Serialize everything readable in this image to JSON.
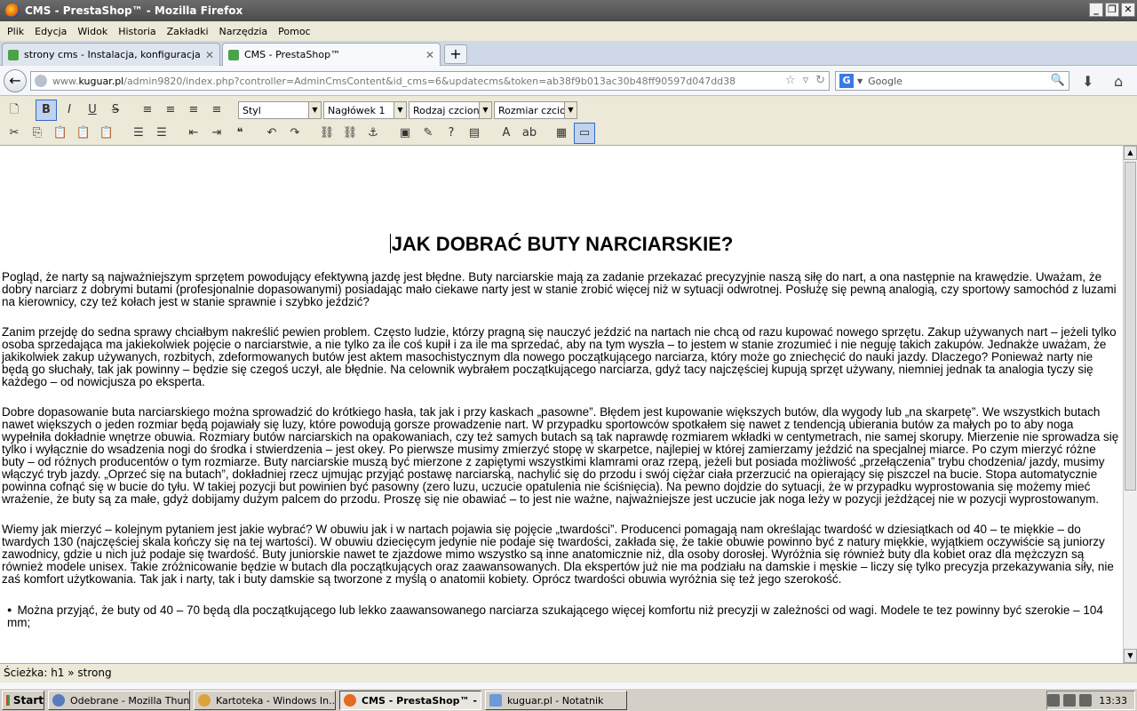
{
  "window": {
    "title": "CMS - PrestaShop™ - Mozilla Firefox",
    "buttons": [
      "_",
      "❐",
      "✕"
    ]
  },
  "menu": [
    "Plik",
    "Edycja",
    "Widok",
    "Historia",
    "Zakładki",
    "Narzędzia",
    "Pomoc"
  ],
  "tabs": [
    {
      "label": "strony cms - Instalacja, konfiguracja i aktu...",
      "active": false
    },
    {
      "label": "CMS - PrestaShop™",
      "active": true
    }
  ],
  "newtab_label": "+",
  "nav": {
    "url_prefix": "www.",
    "url_host": "kuguar.pl",
    "url_path": "/admin9820/index.php?controller=AdminCmsContent&id_cms=6&updatecms&token=ab38f9b013ac30b48ff90597d047dd38",
    "search_engine": "G",
    "search_placeholder": "Google"
  },
  "toolbar": {
    "row1_buttons": [
      {
        "name": "new-doc-icon",
        "glyph": "🗋",
        "on": false
      },
      {
        "name": "bold-button",
        "glyph": "B",
        "on": true
      },
      {
        "name": "italic-button",
        "glyph": "I",
        "on": false
      },
      {
        "name": "underline-button",
        "glyph": "U",
        "on": false
      },
      {
        "name": "strike-button",
        "glyph": "S",
        "on": false
      },
      {
        "name": "align-left-icon",
        "glyph": "≡",
        "on": false
      },
      {
        "name": "align-center-icon",
        "glyph": "≡",
        "on": false
      },
      {
        "name": "align-right-icon",
        "glyph": "≡",
        "on": false
      },
      {
        "name": "align-justify-icon",
        "glyph": "≡",
        "on": false
      }
    ],
    "style_select": "Styl",
    "format_select": "Nagłówek 1",
    "font_select": "Rodzaj czcionki",
    "size_select": "Rozmiar czcionki",
    "row2_buttons": [
      {
        "name": "cut-icon",
        "glyph": "✂"
      },
      {
        "name": "copy-icon",
        "glyph": "⎘"
      },
      {
        "name": "paste-icon",
        "glyph": "📋"
      },
      {
        "name": "paste-text-icon",
        "glyph": "📋"
      },
      {
        "name": "paste-word-icon",
        "glyph": "📋"
      },
      {
        "name": "bullet-list-icon",
        "glyph": "☰"
      },
      {
        "name": "numbered-list-icon",
        "glyph": "☰"
      },
      {
        "name": "outdent-icon",
        "glyph": "⇤"
      },
      {
        "name": "indent-icon",
        "glyph": "⇥"
      },
      {
        "name": "blockquote-icon",
        "glyph": "❝"
      },
      {
        "name": "undo-icon",
        "glyph": "↶"
      },
      {
        "name": "redo-icon",
        "glyph": "↷"
      },
      {
        "name": "link-icon",
        "glyph": "⛓"
      },
      {
        "name": "unlink-icon",
        "glyph": "⛓"
      },
      {
        "name": "anchor-icon",
        "glyph": "⚓"
      },
      {
        "name": "image-icon",
        "glyph": "▣"
      },
      {
        "name": "cleanup-icon",
        "glyph": "✎"
      },
      {
        "name": "help-icon",
        "glyph": "?"
      },
      {
        "name": "html-icon",
        "glyph": "▤"
      },
      {
        "name": "font-color-icon",
        "glyph": "A"
      },
      {
        "name": "bg-color-icon",
        "glyph": "ab"
      },
      {
        "name": "media-icon",
        "glyph": "▦"
      },
      {
        "name": "fullscreen-icon",
        "glyph": "▭"
      }
    ]
  },
  "content": {
    "heading": "JAK DOBRAĆ BUTY NARCIARSKIE?",
    "paragraphs": [
      "Pogląd, że narty są najważniejszym sprzętem powodujący efektywną jazdę jest błędne. Buty narciarskie mają za zadanie przekazać precyzyjnie naszą siłę do nart, a ona następnie na krawędzie. Uważam, że dobry narciarz z dobrymi butami (profesjonalnie dopasowanymi) posiadając mało ciekawe narty jest w stanie zrobić więcej niż w sytuacji odwrotnej. Posłużę się pewną analogią, czy sportowy samochód z luzami na kierownicy, czy też kołach jest w stanie sprawnie i szybko jeździć?",
      "Zanim przejdę do sedna sprawy chciałbym nakreślić pewien problem. Często ludzie, którzy pragną się nauczyć jeździć na nartach nie chcą od razu kupować nowego sprzętu. Zakup używanych nart – jeżeli tylko osoba sprzedająca ma jakiekolwiek pojęcie o narciarstwie, a nie tylko za ile coś kupił i za ile ma sprzedać, aby na tym wyszła – to jestem w stanie zrozumieć i nie neguję takich zakupów. Jednakże uważam, że jakikolwiek zakup używanych, rozbitych, zdeformowanych butów jest aktem masochistycznym dla nowego początkującego narciarza, który może go zniechęcić do nauki jazdy. Dlaczego? Ponieważ narty nie będą go słuchały, tak jak powinny – będzie się czegoś uczył, ale błędnie. Na celownik wybrałem początkującego narciarza, gdyż tacy najczęściej kupują sprzęt używany, niemniej jednak ta analogia tyczy się każdego – od nowicjusza po eksperta.",
      "Dobre dopasowanie buta narciarskiego można sprowadzić do krótkiego hasła, tak jak i przy kaskach „pasowne”. Błędem jest kupowanie większych butów, dla wygody lub „na skarpetę”. We wszystkich butach nawet większych o jeden rozmiar będą pojawiały się luzy, które powodują gorsze prowadzenie nart. W przypadku sportowców spotkałem się nawet z tendencją ubierania butów za małych po to aby noga wypełniła dokładnie wnętrze obuwia. Rozmiary butów narciarskich na opakowaniach, czy też samych butach są tak naprawdę rozmiarem wkładki w centymetrach, nie samej skorupy. Mierzenie nie sprowadza się tylko i wyłącznie do wsadzenia nogi do środka i stwierdzenia – jest okey. Po pierwsze musimy zmierzyć stopę w skarpetce, najlepiej w której zamierzamy jeździć na specjalnej miarce. Po czym mierzyć różne buty – od różnych producentów o tym rozmiarze. Buty narciarskie muszą być mierzone z zapiętymi wszystkimi klamrami oraz rzepą, jeżeli but posiada możliwość „przełączenia” trybu chodzenia/ jazdy, musimy włączyć tryb jazdy. „Oprzeć się na butach”, dokładniej rzecz ujmując przyjąć postawę narciarską, nachylić się do przodu i swój ciężar ciała przerzucić na opierający się piszczel na bucie. Stopa automatycznie powinna cofnąć się w bucie do tyłu. W takiej pozycji but powinien być pasowny (zero luzu, uczucie opatulenia nie ściśnięcia). Na pewno dojdzie do sytuacji, że w przypadku wyprostowania się możemy mieć wrażenie, że buty są za małe, gdyż dobijamy dużym palcem do przodu. Proszę się nie obawiać – to jest nie ważne, najważniejsze jest uczucie jak noga leży w pozycji jeżdżącej nie w pozycji wyprostowanym.",
      "Wiemy jak mierzyć – kolejnym pytaniem jest jakie wybrać? W obuwiu jak i w nartach pojawia się pojęcie „twardości”. Producenci pomagają nam określając twardość w dziesiątkach od 40 – te miękkie – do twardych 130 (najczęściej skala kończy się na tej wartości). W obuwiu dziecięcym jedynie nie podaje się twardości, zakłada się, że takie obuwie powinno być z natury miękkie, wyjątkiem oczywiście są juniorzy zawodnicy, gdzie u nich już podaje się twardość. Buty juniorskie nawet te zjazdowe mimo wszystko są inne anatomicznie niż, dla osoby dorosłej. Wyróżnia się również buty dla kobiet oraz dla mężczyzn są również modele unisex. Takie zróżnicowanie będzie w butach dla początkujących oraz zaawansowanych. Dla ekspertów już nie ma podziału na damskie i męskie – liczy się tylko precyzja przekazywania siły, nie zaś komfort użytkowania. Tak jak i narty, tak i buty damskie są tworzone z myślą o anatomii kobiety. Oprócz twardości obuwia wyróżnia się też jego szerokość."
    ],
    "bullets": [
      "Można przyjąć, że buty od 40 – 70 będą dla początkującego lub lekko zaawansowanego narciarza szukającego więcej komfortu niż precyzji w zależności od wagi. Modele te tez powinny być szerokie – 104 mm;"
    ]
  },
  "pathbar": {
    "label": "Ścieżka:",
    "path": "h1 » strong"
  },
  "taskbar": {
    "start": "Start",
    "tasks": [
      {
        "label": "Odebrane - Mozilla Thun...",
        "active": false
      },
      {
        "label": "Kartoteka - Windows In...",
        "active": false
      },
      {
        "label": "CMS - PrestaShop™ - M...",
        "active": true
      },
      {
        "label": "kuguar.pl - Notatnik",
        "active": false
      }
    ],
    "clock": "13:33"
  }
}
